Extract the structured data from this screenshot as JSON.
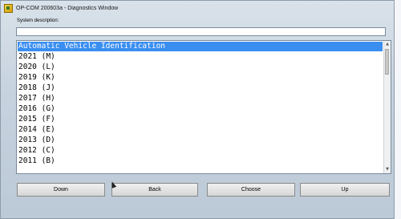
{
  "window": {
    "title": "OP-COM 200603a - Diagnostics Window"
  },
  "system_description": {
    "label": "System description:",
    "value": ""
  },
  "list": {
    "items": [
      "Automatic Vehicle Identification",
      "2021 (M)",
      "2020 (L)",
      "2019 (K)",
      "2018 (J)",
      "2017 (H)",
      "2016 (G)",
      "2015 (F)",
      "2014 (E)",
      "2013 (D)",
      "2012 (C)",
      "2011 (B)"
    ],
    "selected_index": 0
  },
  "buttons": {
    "down": "Down",
    "back": "Back",
    "choose": "Choose",
    "up": "Up"
  },
  "colors": {
    "selection": "#3a8ef0",
    "window_bg": "#c7d3df"
  }
}
